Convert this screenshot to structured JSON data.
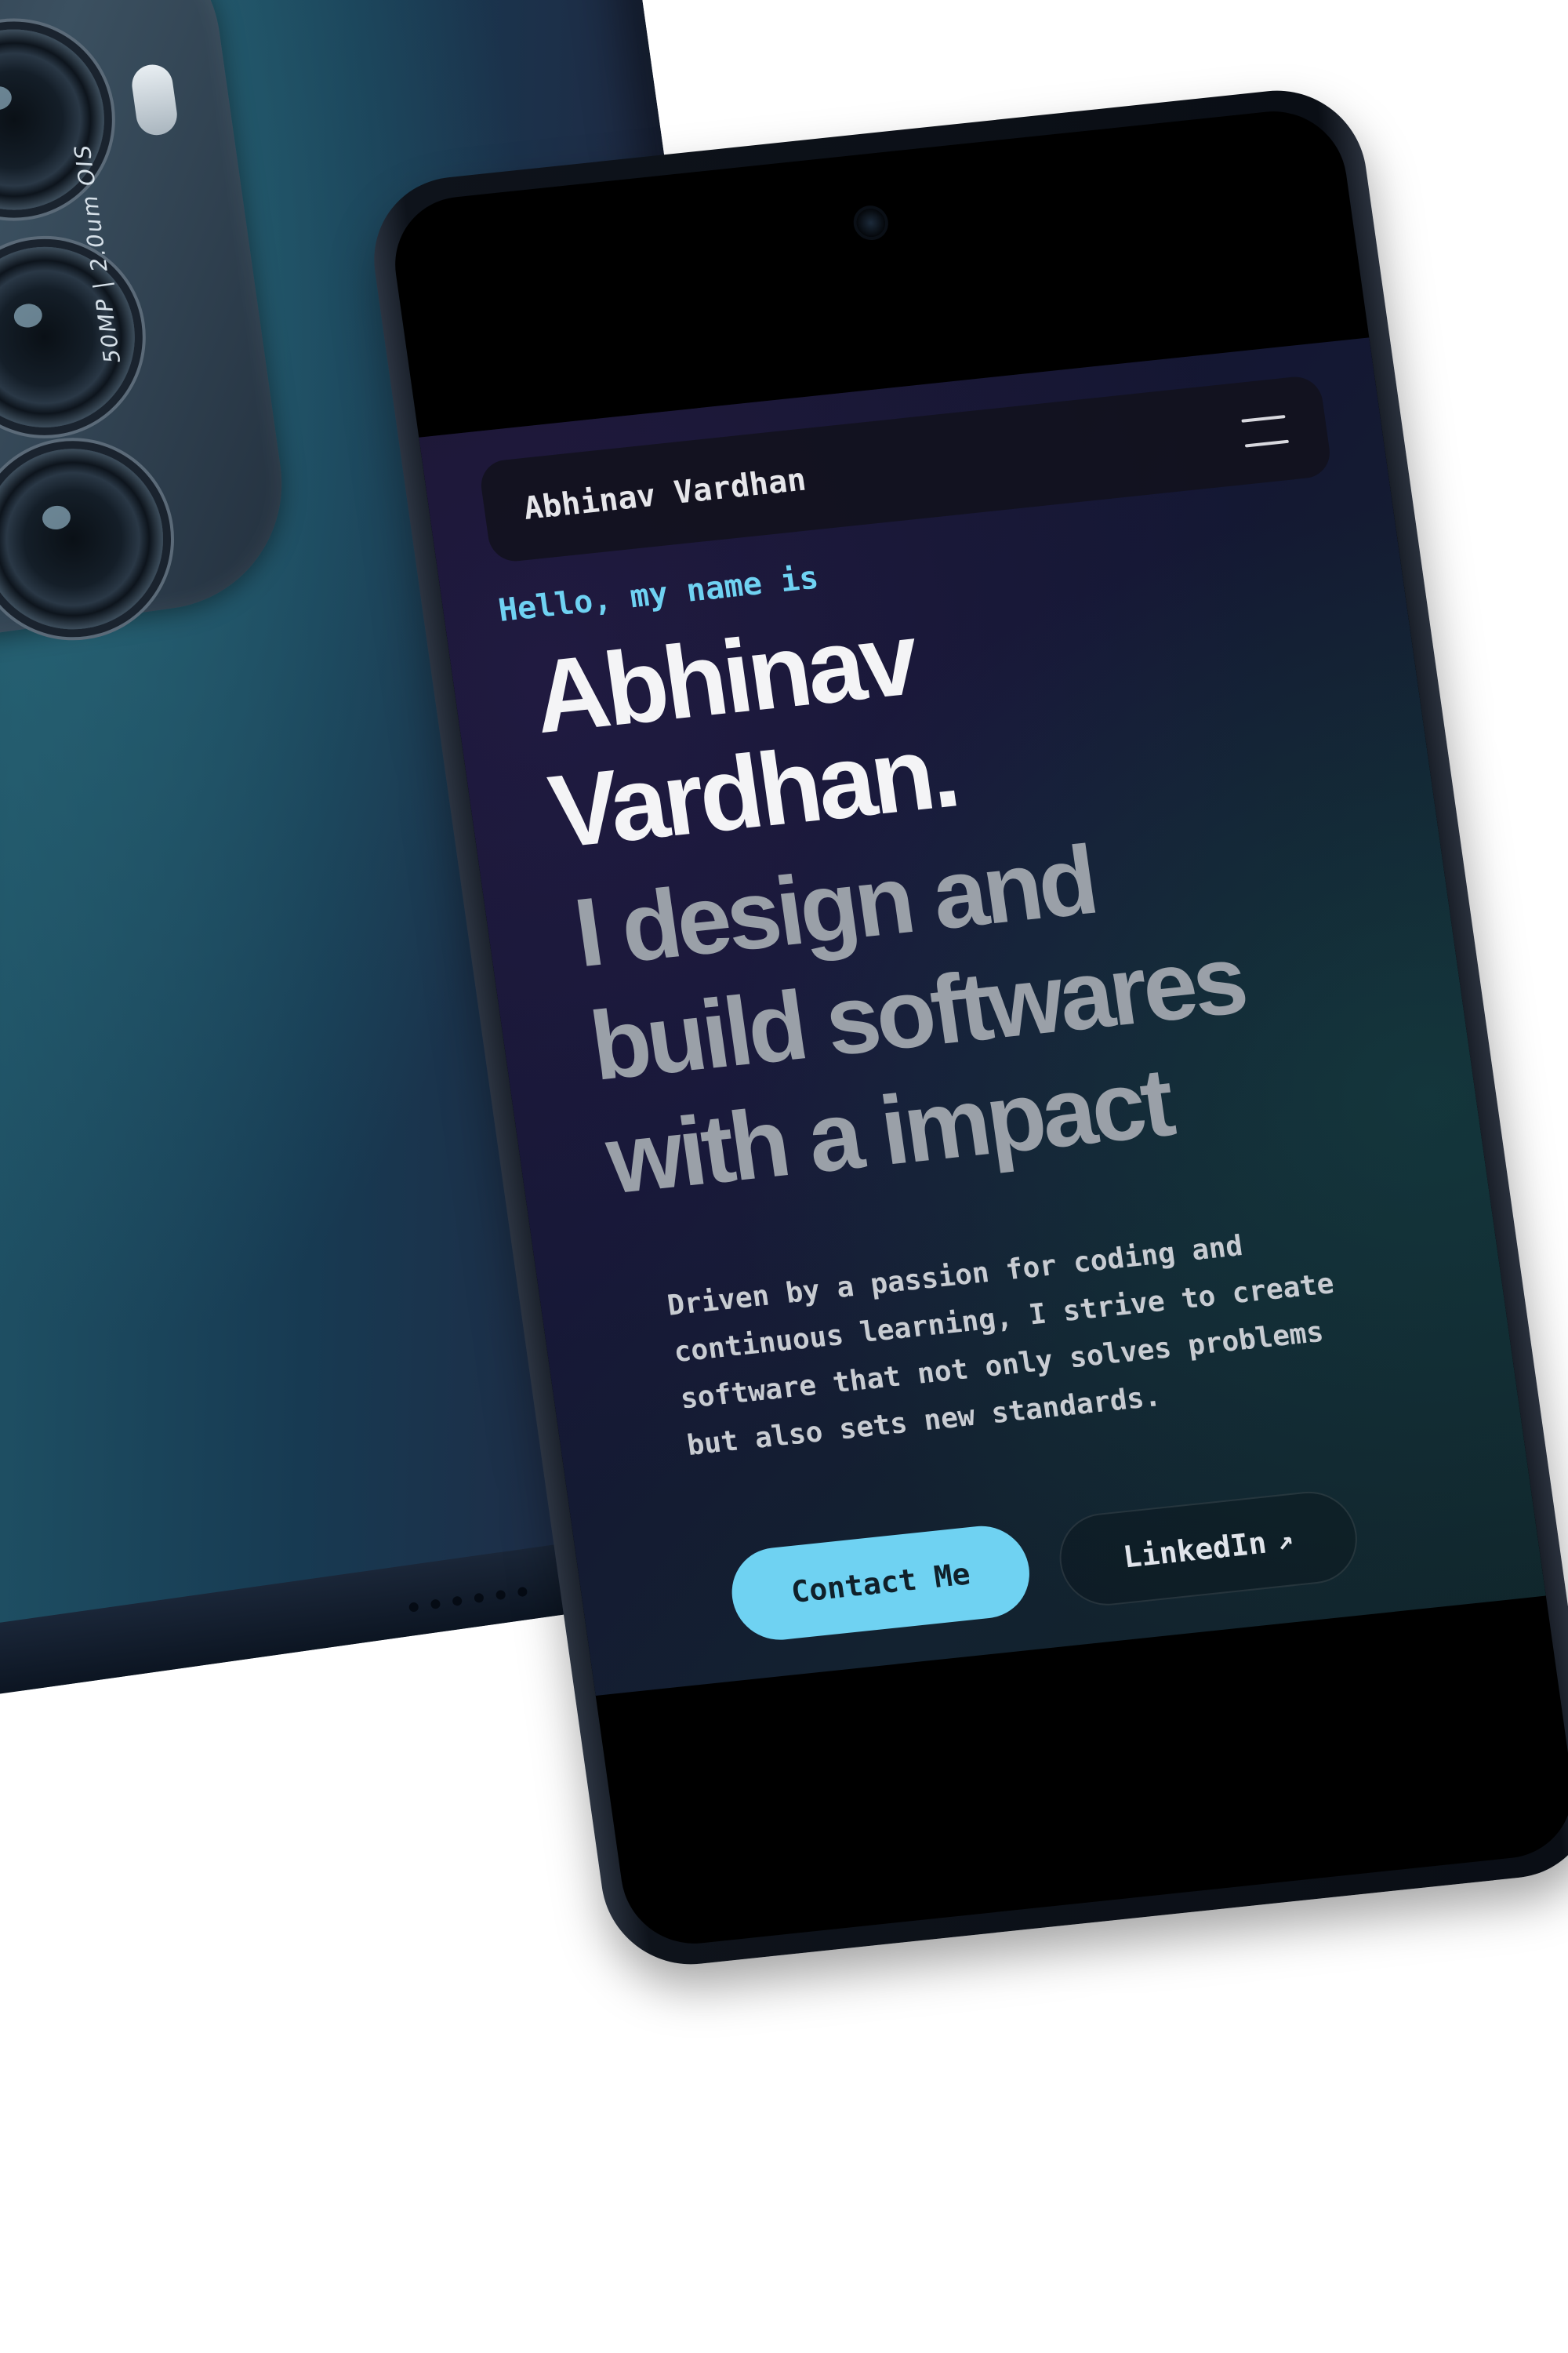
{
  "device_back": {
    "camera_spec": "50MP | 2.0um OIS"
  },
  "navbar": {
    "brand": "Abhinav Vardhan",
    "menu_icon": "hamburger-menu-icon"
  },
  "hero": {
    "greeting": "Hello, my name is",
    "name_line1": "Abhinav",
    "name_line2": "Vardhan.",
    "tagline_line1": "I design and",
    "tagline_line2": "build softwares",
    "tagline_line3": "with a impact",
    "description": "Driven by a passion for coding and continuous learning, I strive to create software that not only solves problems but also sets new standards."
  },
  "buttons": {
    "contact_label": "Contact Me",
    "linkedin_label": "LinkedIn",
    "linkedin_icon": "external-link-arrow-icon",
    "linkedin_arrow": "↗"
  },
  "colors": {
    "accent": "#6fd2f2",
    "heading": "#f4f4f6",
    "tagline": "#9aa0a8",
    "page_bg": "#141733"
  }
}
